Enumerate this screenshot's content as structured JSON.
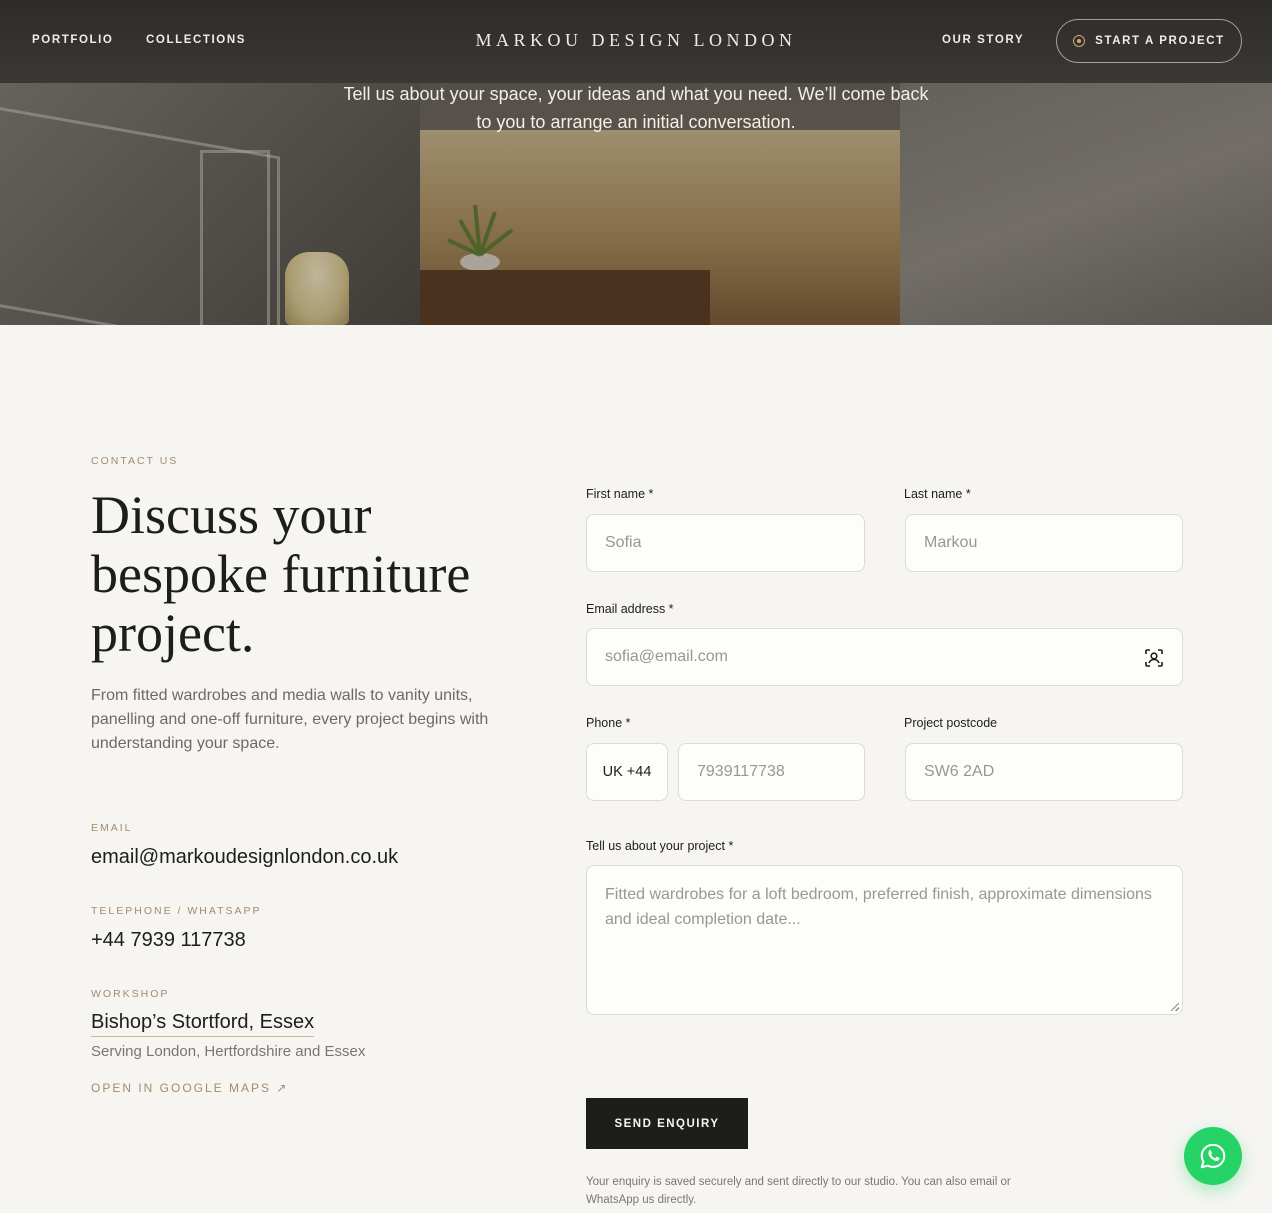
{
  "nav": {
    "portfolio": "PORTFOLIO",
    "collections": "COLLECTIONS",
    "logo": "MARKOU DESIGN LONDON",
    "our_story": "OUR STORY",
    "cta": "START A PROJECT"
  },
  "hero": {
    "text": "Tell us about your space, your ideas and what you need. We’ll come back to you to arrange an initial conversation."
  },
  "contact": {
    "eyebrow": "CONTACT US",
    "headline": "Discuss your bespoke furniture project.",
    "intro": "From fitted wardrobes and media walls to vanity units, panelling and one-off furniture, every project begins with understanding your space.",
    "email_label": "EMAIL",
    "email": "email@markoudesignlondon.co.uk",
    "phone_label": "TELEPHONE / WHATSAPP",
    "phone": "+44 7939 117738",
    "workshop_label": "WORKSHOP",
    "workshop": "Bishop’s Stortford, Essex",
    "serving": "Serving London, Hertfordshire and Essex",
    "maps_link": "OPEN IN GOOGLE MAPS ↗"
  },
  "form": {
    "first_name_label": "First name *",
    "first_name_placeholder": "Sofia",
    "last_name_label": "Last name *",
    "last_name_placeholder": "Markou",
    "email_label": "Email address *",
    "email_placeholder": "sofia@email.com",
    "phone_label": "Phone *",
    "country_code": "UK +44",
    "phone_placeholder": "7939117738",
    "postcode_label": "Project postcode",
    "postcode_placeholder": "SW6 2AD",
    "project_label": "Tell us about your project *",
    "project_placeholder": "Fitted wardrobes for a loft bedroom, preferred finish, approximate dimensions and ideal completion date...",
    "submit": "SEND ENQUIRY",
    "note": "Your enquiry is saved securely and sent directly to our studio. You can also email or WhatsApp us directly."
  },
  "colors": {
    "accent": "#a48b6c",
    "dark": "#1d1d1b",
    "whatsapp": "#25d366"
  }
}
